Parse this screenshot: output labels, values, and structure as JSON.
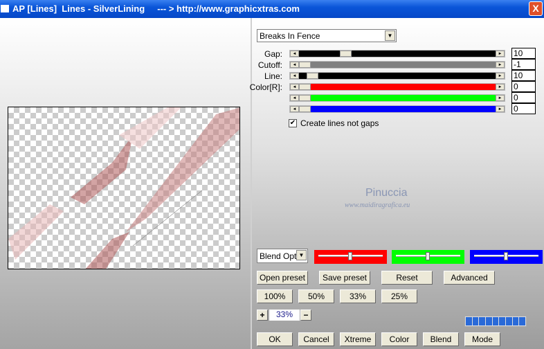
{
  "window": {
    "title": "AP [Lines]  Lines - SilverLining     --- > http://www.graphicxtras.com",
    "close_label": "X"
  },
  "preset_dropdown": {
    "value": "Breaks In Fence"
  },
  "sliders": [
    {
      "label": "Gap:",
      "value": "10",
      "color": "#000000",
      "position": 0.22
    },
    {
      "label": "Cutoff:",
      "value": "-1",
      "color": "#808080",
      "position": 0.0
    },
    {
      "label": "Line:",
      "value": "10",
      "color": "#000000",
      "position": 0.04
    },
    {
      "label": "Color[R]:",
      "value": "0",
      "color": "#ff0000",
      "position": 0.0
    },
    {
      "label": "",
      "value": "0",
      "color": "#00ff00",
      "position": 0.0
    },
    {
      "label": "",
      "value": "0",
      "color": "#0000ff",
      "position": 0.0
    }
  ],
  "checkbox": {
    "label": "Create lines not gaps",
    "checked": true
  },
  "watermark": {
    "name": "Pinuccia",
    "url": "www.maidiragrafica.eu"
  },
  "blend_dropdown": {
    "value": "Blend Opti"
  },
  "blend_sliders": [
    {
      "color": "#ff0000",
      "position": 0.5
    },
    {
      "color": "#00ff00",
      "position": 0.5
    },
    {
      "color": "#0000ff",
      "position": 0.5
    }
  ],
  "buttons": {
    "open_preset": "Open preset",
    "save_preset": "Save preset",
    "reset": "Reset",
    "advanced": "Advanced",
    "zoom100": "100%",
    "zoom50": "50%",
    "zoom33": "33%",
    "zoom25": "25%",
    "ok": "OK",
    "cancel": "Cancel",
    "xtreme": "Xtreme",
    "color": "Color",
    "blend": "Blend",
    "mode": "Mode"
  },
  "zoom": {
    "plus": "+",
    "minus": "−",
    "value": "33%"
  }
}
